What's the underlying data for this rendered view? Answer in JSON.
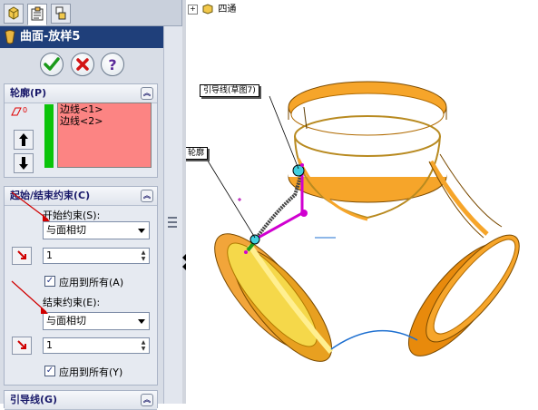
{
  "property_manager": {
    "title": "曲面-放样5",
    "tabs": [
      "feature-manager",
      "property-manager",
      "configuration-manager"
    ],
    "actions": [
      "ok",
      "cancel",
      "help"
    ],
    "profile_section": {
      "title": "轮廓(P)",
      "items": [
        "边线<1>",
        "边线<2>"
      ]
    },
    "constraints_section": {
      "title": "起始/结束约束(C)",
      "start_label": "开始约束(S):",
      "start_value": "与面相切",
      "start_spin": "1",
      "start_apply_all": "应用到所有(A)",
      "end_label": "结束约束(E):",
      "end_value": "与面相切",
      "end_spin": "1",
      "end_apply_all": "应用到所有(Y)"
    },
    "guide_section": {
      "title": "引导线(G)"
    }
  },
  "graphics": {
    "tree_label": "四通",
    "callout_guide": "引导线(草图7)",
    "callout_profile": "轮廓"
  },
  "colors": {
    "header_bg": "#1f3f7a",
    "profile_list_bg": "#fc8483",
    "profile_bar": "#0ac40a",
    "surface_orange": "#f29a18",
    "guide_magenta": "#d000d0",
    "edge_blue": "#1d6fd0"
  }
}
